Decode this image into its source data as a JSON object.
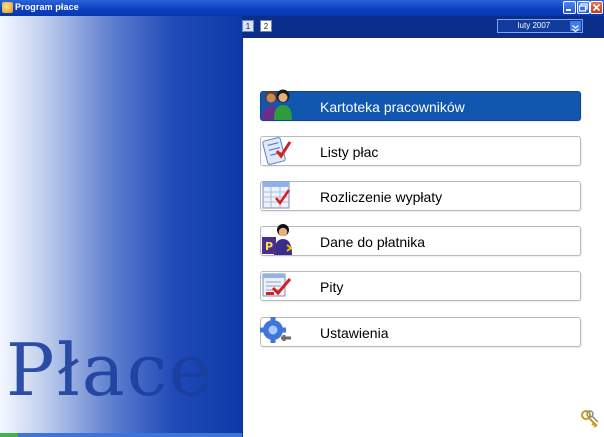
{
  "window": {
    "title": "Program płace",
    "icon": "app-icon"
  },
  "title_controls": [
    "minimize-icon",
    "maximize-icon",
    "close-icon"
  ],
  "pager": {
    "pages": [
      "1",
      "2"
    ],
    "active": "1"
  },
  "month_selector": {
    "value": "luty 2007",
    "icon": "double-chevron-down-icon"
  },
  "watermark": "Płace",
  "menu": [
    {
      "label": "Kartoteka pracowników",
      "icon": "people-icon",
      "active": true
    },
    {
      "label": "Listy płac",
      "icon": "checklist-icon",
      "active": false
    },
    {
      "label": "Rozliczenie wypłaty",
      "icon": "ledger-icon",
      "active": false
    },
    {
      "label": "Dane do płatnika",
      "icon": "payer-icon",
      "active": false
    },
    {
      "label": "Pity",
      "icon": "tax-form-icon",
      "active": false
    },
    {
      "label": "Ustawienia",
      "icon": "settings-gear-icon",
      "active": false
    }
  ],
  "footer_icon": "keys-icon",
  "colors": {
    "accent": "#1157b0",
    "titlebar": "#0a3fc2",
    "panel_dark": "#0d3aa8",
    "watermark": "#1b3f9e"
  }
}
